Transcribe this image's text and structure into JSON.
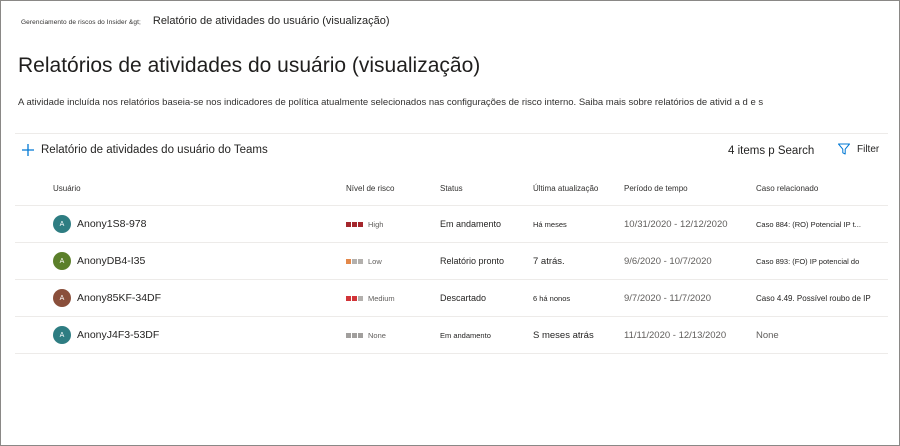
{
  "breadcrumb": {
    "parent": "Gerenciamento de riscos do Insider &gt;",
    "current": "Relatório de atividades do usuário (visualização)"
  },
  "title": "Relatórios de atividades do usuário (visualização)",
  "description": "A atividade incluída nos relatórios baseia-se nos indicadores de política atualmente selecionados nas configurações de risco interno. Saiba mais sobre relatórios de ativid a d e s",
  "toolbar": {
    "add_label": "Relatório de atividades do usuário do Teams",
    "add_icon": "plus-icon",
    "items_count": "4 items p Search",
    "filter_label": "Filter",
    "filter_icon": "funnel-icon"
  },
  "table": {
    "headers": {
      "user": "Usuário",
      "risk": "Nível de risco",
      "status": "Status",
      "updated": "Última atualização",
      "period": "Período de tempo",
      "case": "Caso relacionado"
    },
    "rows": [
      {
        "initial": "A",
        "avatar_color": "#2e7d82",
        "name": "Anony1S8-978",
        "risk": "High",
        "risk_colors": [
          "#a4262c",
          "#a4262c",
          "#a4262c"
        ],
        "status": "Em andamento",
        "updated": "Há meses",
        "period": "10/31/2020 - 12/12/2020",
        "case": "Caso 884: (RO) Potencial IP t..."
      },
      {
        "initial": "A",
        "avatar_color": "#5b7f2a",
        "name": "AnonyDB4-I35",
        "risk": "Low",
        "risk_colors": [
          "#e3884a",
          "#b3b0ad",
          "#b3b0ad"
        ],
        "status": "Relatório pronto",
        "updated": "7 atrás.",
        "period": "9/6/2020 - 10/7/2020",
        "case": "Caso 893: (FO) IP potencial do"
      },
      {
        "initial": "A",
        "avatar_color": "#8a4f3b",
        "name": "Anony85KF-34DF",
        "risk": "Medium",
        "risk_colors": [
          "#d13438",
          "#d13438",
          "#b3b0ad"
        ],
        "status": "Descartado",
        "updated": "6 há nonos",
        "period": "9/7/2020 - 11/7/2020",
        "case": "Caso 4.49. Possível roubo de IP"
      },
      {
        "initial": "A",
        "avatar_color": "#2e7d82",
        "name": "AnonyJ4F3-53DF",
        "risk": "None",
        "risk_colors": [
          "#a19f9d",
          "#a19f9d",
          "#a19f9d"
        ],
        "status": "Em andamento",
        "updated": "S meses atrás",
        "period": "11/11/2020 - 12/13/2020",
        "case": "None"
      }
    ]
  }
}
